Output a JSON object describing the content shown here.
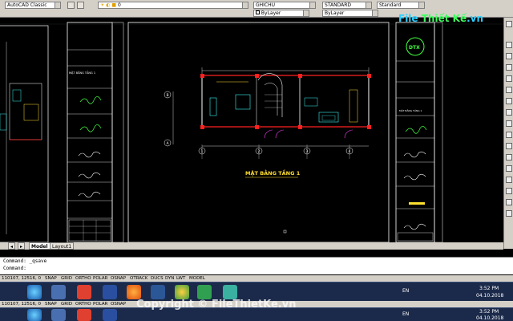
{
  "toolbar": {
    "workspace": "AutoCAD Classic",
    "layer": "0",
    "text_style": "GHICHU",
    "dim_style": "STANDARD",
    "table_style": "Standard",
    "color": "ByLayer",
    "linetype": "ByLayer"
  },
  "brand": {
    "part1": "File",
    "part2": "Thiết Kế",
    "part3": ".vn"
  },
  "drawing": {
    "plan_title": "MẶT BẰNG TẦNG 1",
    "left_sheet_title": "MẶT BẰNG TẦNG 1",
    "left_sheet_side": "MẶT BẰNG",
    "axis_numbers": [
      "1",
      "2",
      "3",
      "4"
    ],
    "axis_letters": [
      "B",
      "A"
    ],
    "title_block_heading": "MẶT BẰNG TẦNG 1"
  },
  "layout_tabs": [
    "Model",
    "Layout1"
  ],
  "command_lines": [
    "Command: _qsave",
    "Command:"
  ],
  "status_bar": {
    "coords": "110107, 12516, 0",
    "buttons": [
      "SNAP",
      "GRID",
      "ORTHO",
      "POLAR",
      "OSNAP",
      "OTRACK",
      "DUCS",
      "DYN",
      "LWT",
      "MODEL"
    ]
  },
  "taskbar": {
    "language": "EN",
    "time": "3:52 PM",
    "date": "04.10.2018"
  },
  "watermark": "Copyright © FileThietKe.vn",
  "colors": {
    "background": "#000000",
    "line_white": "#ffffff",
    "line_red": "#ff2020",
    "line_cyan": "#3cf0f0",
    "line_yellow": "#ffe030",
    "line_green": "#40ff40",
    "line_magenta": "#ff40ff",
    "taskbar": "#1b2a4a"
  }
}
